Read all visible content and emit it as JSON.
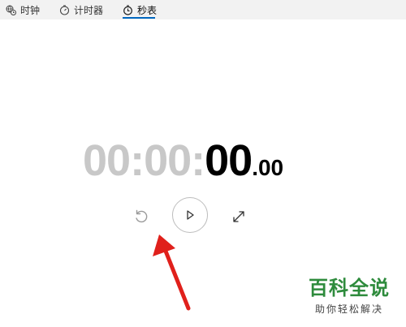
{
  "tabs": [
    {
      "label": "时钟",
      "icon": "globe-clock-icon",
      "active": false
    },
    {
      "label": "计时器",
      "icon": "timer-icon",
      "active": false
    },
    {
      "label": "秒表",
      "icon": "stopwatch-icon",
      "active": true
    }
  ],
  "stopwatch": {
    "hours": "00",
    "colon1": ":",
    "minutes": "00",
    "colon2": ":",
    "seconds": "00",
    "fraction": ".00"
  },
  "controls": {
    "reset_icon": "reset-icon",
    "play_icon": "play-icon",
    "expand_icon": "expand-icon"
  },
  "annotation": {
    "arrow_color": "#e0201b"
  },
  "watermark": {
    "title": "百科全说",
    "subtitle": "助你轻松解决"
  },
  "colors": {
    "accent": "#0067c0",
    "dim_digits": "#c8c8c8",
    "watermark": "#2e8b3c"
  }
}
